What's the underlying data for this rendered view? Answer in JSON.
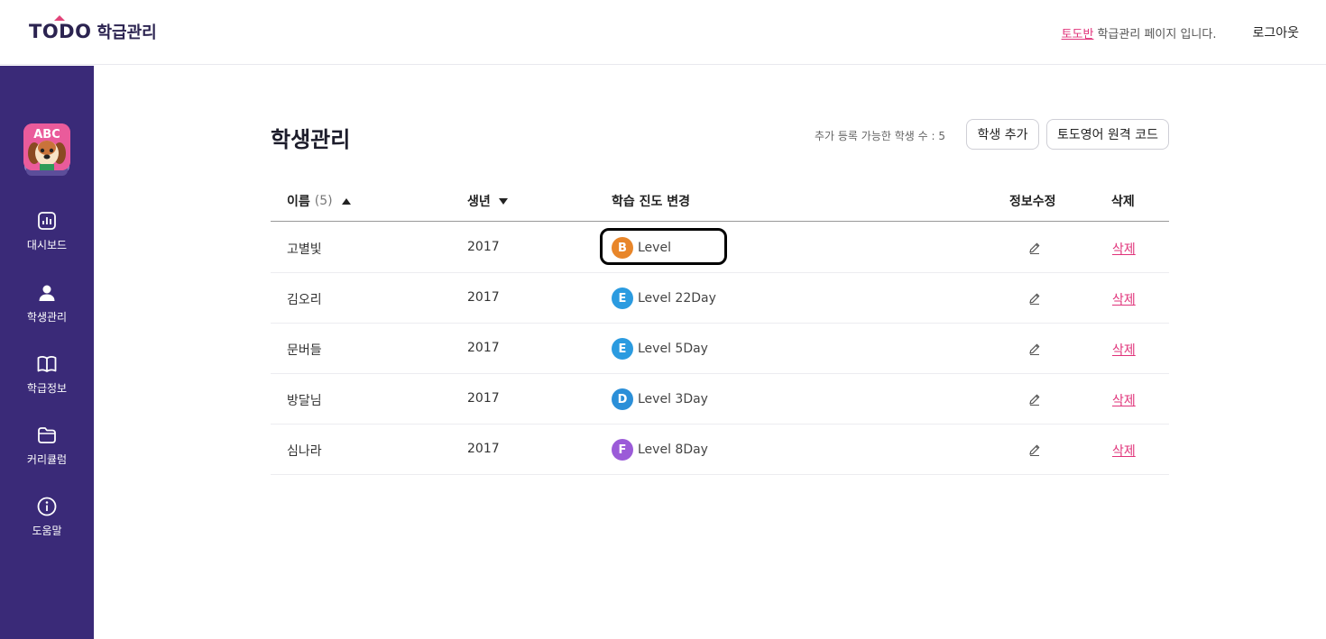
{
  "header": {
    "logo_main": "TODO",
    "logo_sub": "학급관리",
    "class_name": "토도반",
    "class_suffix": "학급관리 페이지 입니다.",
    "logout": "로그아웃"
  },
  "sidebar": {
    "avatar_text": "ABC",
    "items": [
      {
        "label": "대시보드",
        "icon": "dashboard-icon"
      },
      {
        "label": "학생관리",
        "icon": "user-icon"
      },
      {
        "label": "학급정보",
        "icon": "book-icon"
      },
      {
        "label": "커리큘럼",
        "icon": "folder-icon"
      },
      {
        "label": "도움말",
        "icon": "info-icon"
      }
    ]
  },
  "main": {
    "title": "학생관리",
    "capacity_text": "추가 등록 가능한 학생 수 : 5",
    "add_button": "학생 추가",
    "code_button": "토도영어 원격 코드",
    "columns": {
      "name": "이름",
      "name_count": "(5)",
      "year": "생년",
      "progress": "학습 진도 변경",
      "edit": "정보수정",
      "delete": "삭제"
    },
    "rows": [
      {
        "name": "고별빛",
        "year": "2017",
        "badge": "B",
        "badge_color": "#e8862a",
        "level": "Level",
        "delete": "삭제"
      },
      {
        "name": "김오리",
        "year": "2017",
        "badge": "E",
        "badge_color": "#2b9be0",
        "level": "Level 22Day",
        "delete": "삭제"
      },
      {
        "name": "문버들",
        "year": "2017",
        "badge": "E",
        "badge_color": "#2b9be0",
        "level": "Level 5Day",
        "delete": "삭제"
      },
      {
        "name": "방달님",
        "year": "2017",
        "badge": "D",
        "badge_color": "#2b8fd8",
        "level": "Level 3Day",
        "delete": "삭제"
      },
      {
        "name": "심나라",
        "year": "2017",
        "badge": "F",
        "badge_color": "#9b5bd8",
        "level": "Level 8Day",
        "delete": "삭제"
      }
    ]
  },
  "colors": {
    "sidebar_bg": "#3a2a78",
    "accent": "#e0337a"
  }
}
